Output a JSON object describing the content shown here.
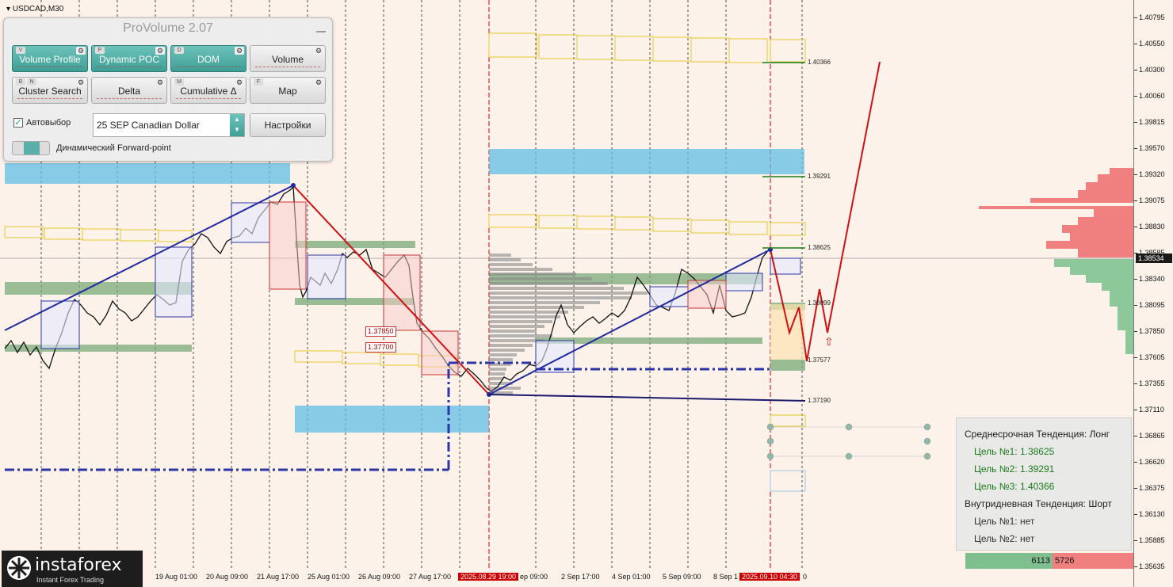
{
  "symbol": "USDCAD,M30",
  "panel": {
    "title": "ProVolume 2.07",
    "buttons": [
      {
        "label": "Volume Profile",
        "key": "V",
        "active": true
      },
      {
        "label": "Dynamic POC",
        "key": "P",
        "active": true
      },
      {
        "label": "DOM",
        "key": "D",
        "active": true
      },
      {
        "label": "Volume",
        "key": "",
        "active": false
      },
      {
        "label": "Cluster Search",
        "key": "B",
        "key2": "N",
        "active": false
      },
      {
        "label": "Delta",
        "key": "",
        "active": false
      },
      {
        "label": "Cumulative Δ",
        "key": "M",
        "active": false
      },
      {
        "label": "Map",
        "key": "F",
        "active": false
      }
    ],
    "autoselect_label": "Автовыбор",
    "autoselect_checked": true,
    "instrument": "25 SEP Canadian Dollar",
    "settings_label": "Настройки",
    "forward_point_label": "Динамический Forward-point"
  },
  "price_axis": [
    "1.40795",
    "1.40550",
    "1.40300",
    "1.40060",
    "1.39815",
    "1.39570",
    "1.39320",
    "1.39075",
    "1.38830",
    "1.38585",
    "1.38340",
    "1.38095",
    "1.37850",
    "1.37605",
    "1.37355",
    "1.37110",
    "1.36865",
    "1.36620",
    "1.36375",
    "1.36130",
    "1.35885",
    "1.35635"
  ],
  "current_price": "1.38534",
  "time_axis": [
    {
      "label": "19 Aug 01:00",
      "hl": false
    },
    {
      "label": "20 Aug 09:00",
      "hl": false
    },
    {
      "label": "21 Aug 17:00",
      "hl": false
    },
    {
      "label": "25 Aug 01:00",
      "hl": false
    },
    {
      "label": "26 Aug 09:00",
      "hl": false
    },
    {
      "label": "27 Aug 17:00",
      "hl": false
    },
    {
      "label": "2025.08.29 19:00",
      "hl": true
    },
    {
      "label": "ep 09:00",
      "hl": false
    },
    {
      "label": "2 Sep 17:00",
      "hl": false
    },
    {
      "label": "4 Sep 01:00",
      "hl": false
    },
    {
      "label": "5 Sep 09:00",
      "hl": false
    },
    {
      "label": "8 Sep 1",
      "hl": false
    },
    {
      "label": "2025.09.10 04:30",
      "hl": true
    },
    {
      "label": "0",
      "hl": false
    }
  ],
  "levels": [
    "1.40366",
    "1.39291",
    "1.38625",
    "1.38099",
    "1.37577",
    "1.37190"
  ],
  "price_tags": [
    "1.37850",
    "1.37700"
  ],
  "trend": {
    "medium_title": "Среднесрочная Тенденция: Лонг",
    "targets": [
      "Цель №1: 1.38625",
      "Цель №2: 1.39291",
      "Цель №3: 1.40366"
    ],
    "intraday_title": "Внутридневная Тенденция: Шорт",
    "intraday_targets": [
      "Цель №1: нет",
      "Цель №2: нет"
    ]
  },
  "volume": {
    "buy": "6113",
    "sell": "5726",
    "buy_color": "#7fbf8f",
    "sell_color": "#f08080"
  },
  "logo": {
    "text": "instaforex",
    "sub": "Instant Forex Trading"
  },
  "colors": {
    "trend_blue": "#1f2aa0",
    "trend_red": "#d01010",
    "teal": "#5ab0a8",
    "sky": "#5fbde5",
    "yellow": "#f0d040",
    "green_zone": "#7aaa78"
  }
}
